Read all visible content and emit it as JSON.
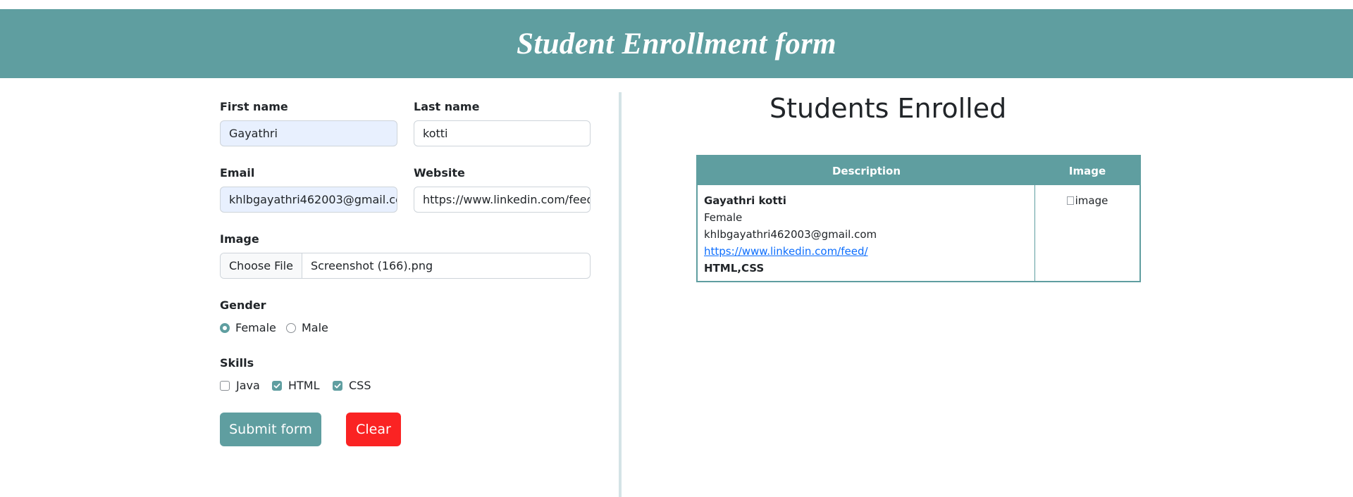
{
  "header": {
    "title": "Student Enrollment form"
  },
  "form": {
    "first_name": {
      "label": "First name",
      "value": "Gayathri"
    },
    "last_name": {
      "label": "Last name",
      "value": "kotti"
    },
    "email": {
      "label": "Email",
      "value": "khlbgayathri462003@gmail.com"
    },
    "website": {
      "label": "Website",
      "value": "https://www.linkedin.com/feed/"
    },
    "image": {
      "label": "Image",
      "button": "Choose File",
      "file_name": "Screenshot (166).png"
    },
    "gender": {
      "label": "Gender",
      "options": [
        "Female",
        "Male"
      ],
      "selected": "Female"
    },
    "skills": {
      "label": "Skills",
      "options": [
        "Java",
        "HTML",
        "CSS"
      ],
      "checked": [
        "HTML",
        "CSS"
      ]
    },
    "submit_label": "Submit form",
    "clear_label": "Clear"
  },
  "table": {
    "title": "Students Enrolled",
    "headers": [
      "Description",
      "Image"
    ],
    "rows": [
      {
        "name": "Gayathri kotti",
        "gender": "Female",
        "email": "khlbgayathri462003@gmail.com",
        "website": "https://www.linkedin.com/feed/",
        "skills": "HTML,CSS",
        "image_alt": "image"
      }
    ]
  },
  "colors": {
    "accent": "#5f9ea0",
    "clear": "#fa2323",
    "link": "#0d6efd"
  }
}
